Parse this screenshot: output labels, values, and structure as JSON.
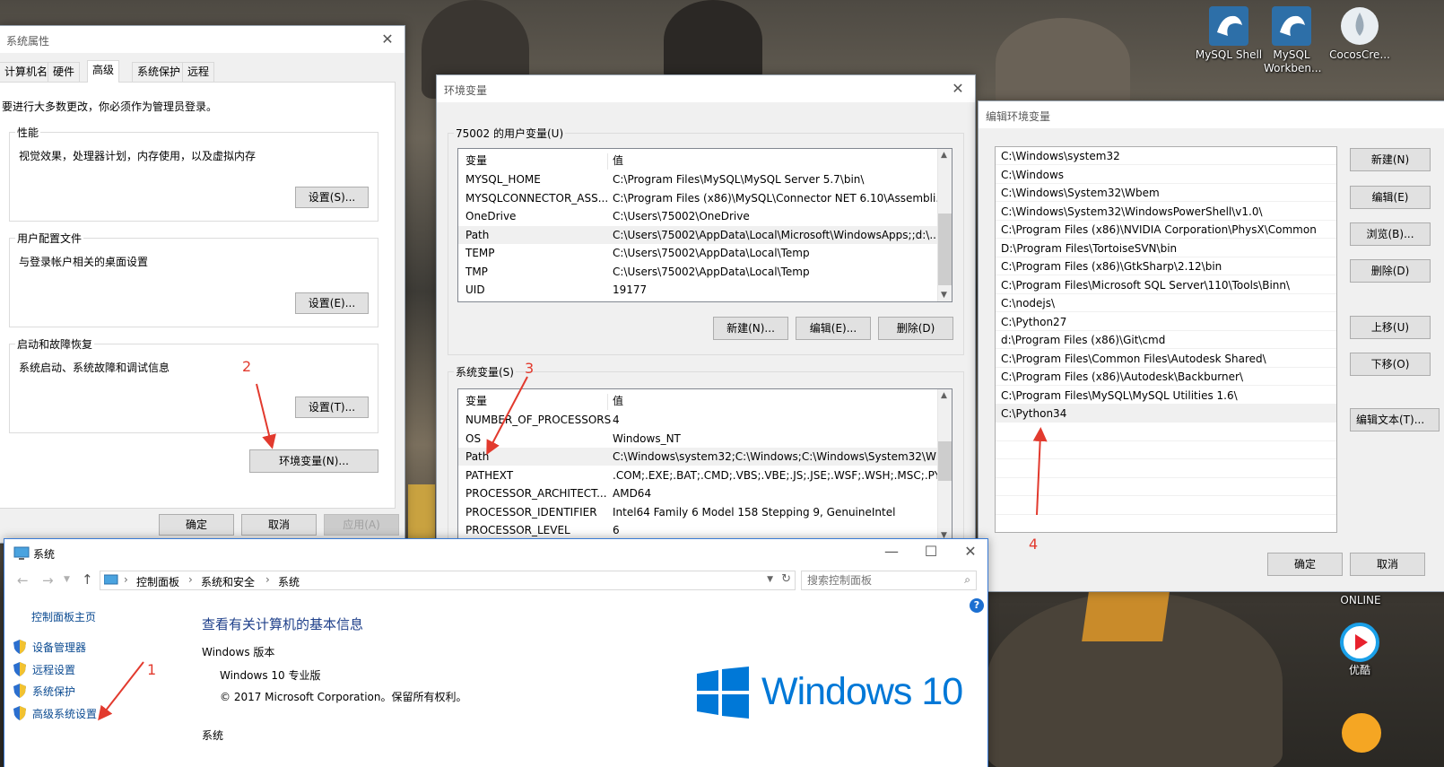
{
  "desktop": {
    "icons": [
      {
        "label": "MySQL Shell",
        "icon": "dolphin-icon"
      },
      {
        "label": "MySQL Workben...",
        "icon": "dolphin-icon"
      },
      {
        "label": "CocosCre...",
        "icon": "cocos-icon"
      }
    ],
    "youku_label": "优酷",
    "online_text": "ONLINE"
  },
  "sysprops": {
    "title": "系统属性",
    "tabs": [
      "计算机名",
      "硬件",
      "高级",
      "系统保护",
      "远程"
    ],
    "active_tab": "高级",
    "admin_note": "要进行大多数更改，你必须作为管理员登录。",
    "perf": {
      "title": "性能",
      "desc": "视觉效果，处理器计划，内存使用，以及虚拟内存",
      "button": "设置(S)..."
    },
    "profile": {
      "title": "用户配置文件",
      "desc": "与登录帐户相关的桌面设置",
      "button": "设置(E)..."
    },
    "startup": {
      "title": "启动和故障恢复",
      "desc": "系统启动、系统故障和调试信息",
      "button": "设置(T)..."
    },
    "env_button": "环境变量(N)...",
    "ok": "确定",
    "cancel": "取消",
    "apply": "应用(A)"
  },
  "envvars": {
    "title": "环境变量",
    "user_group": "75002 的用户变量(U)",
    "col_var": "变量",
    "col_val": "值",
    "user_rows": [
      {
        "name": "MYSQL_HOME",
        "value": "C:\\Program Files\\MySQL\\MySQL Server 5.7\\bin\\"
      },
      {
        "name": "MYSQLCONNECTOR_ASS...",
        "value": "C:\\Program Files (x86)\\MySQL\\Connector NET 6.10\\Assembli..."
      },
      {
        "name": "OneDrive",
        "value": "C:\\Users\\75002\\OneDrive"
      },
      {
        "name": "Path",
        "value": "C:\\Users\\75002\\AppData\\Local\\Microsoft\\WindowsApps;;d:\\..."
      },
      {
        "name": "TEMP",
        "value": "C:\\Users\\75002\\AppData\\Local\\Temp"
      },
      {
        "name": "TMP",
        "value": "C:\\Users\\75002\\AppData\\Local\\Temp"
      },
      {
        "name": "UID",
        "value": "19177"
      }
    ],
    "user_buttons": {
      "new": "新建(N)...",
      "edit": "编辑(E)...",
      "delete": "删除(D)"
    },
    "sys_group": "系统变量(S)",
    "sys_rows": [
      {
        "name": "NUMBER_OF_PROCESSORS",
        "value": "4"
      },
      {
        "name": "OS",
        "value": "Windows_NT"
      },
      {
        "name": "Path",
        "value": "C:\\Windows\\system32;C:\\Windows;C:\\Windows\\System32\\Wb..."
      },
      {
        "name": "PATHEXT",
        "value": ".COM;.EXE;.BAT;.CMD;.VBS;.VBE;.JS;.JSE;.WSF;.WSH;.MSC;.PY"
      },
      {
        "name": "PROCESSOR_ARCHITECT...",
        "value": "AMD64"
      },
      {
        "name": "PROCESSOR_IDENTIFIER",
        "value": "Intel64 Family 6 Model 158 Stepping 9, GenuineIntel"
      },
      {
        "name": "PROCESSOR_LEVEL",
        "value": "6"
      }
    ]
  },
  "editenv": {
    "title": "编辑环境变量",
    "paths": [
      "C:\\Windows\\system32",
      "C:\\Windows",
      "C:\\Windows\\System32\\Wbem",
      "C:\\Windows\\System32\\WindowsPowerShell\\v1.0\\",
      "C:\\Program Files (x86)\\NVIDIA Corporation\\PhysX\\Common",
      "D:\\Program Files\\TortoiseSVN\\bin",
      "C:\\Program Files (x86)\\GtkSharp\\2.12\\bin",
      "C:\\Program Files\\Microsoft SQL Server\\110\\Tools\\Binn\\",
      "C:\\nodejs\\",
      "C:\\Python27",
      "d:\\Program Files (x86)\\Git\\cmd",
      "C:\\Program Files\\Common Files\\Autodesk Shared\\",
      "C:\\Program Files (x86)\\Autodesk\\Backburner\\",
      "C:\\Program Files\\MySQL\\MySQL Utilities 1.6\\",
      "C:\\Python34"
    ],
    "buttons": {
      "new": "新建(N)",
      "edit": "编辑(E)",
      "browse": "浏览(B)...",
      "delete": "删除(D)",
      "up": "上移(U)",
      "down": "下移(O)",
      "edittext": "编辑文本(T)..."
    },
    "ok": "确定",
    "cancel": "取消"
  },
  "system": {
    "title": "系统",
    "breadcrumb": [
      "控制面板",
      "系统和安全",
      "系统"
    ],
    "search_placeholder": "搜索控制面板",
    "sidebar_home": "控制面板主页",
    "sidebar_links": [
      "设备管理器",
      "远程设置",
      "系统保护",
      "高级系统设置"
    ],
    "heading": "查看有关计算机的基本信息",
    "edition_section": "Windows 版本",
    "edition": "Windows 10 专业版",
    "copyright": "© 2017 Microsoft Corporation。保留所有权利。",
    "logo_text": "Windows 10",
    "system_section": "系统"
  },
  "annotations": [
    "1",
    "2",
    "3",
    "4"
  ],
  "colors": {
    "annotation": "#e23a2e",
    "win_blue": "#0078d7",
    "link": "#0a4a91"
  }
}
